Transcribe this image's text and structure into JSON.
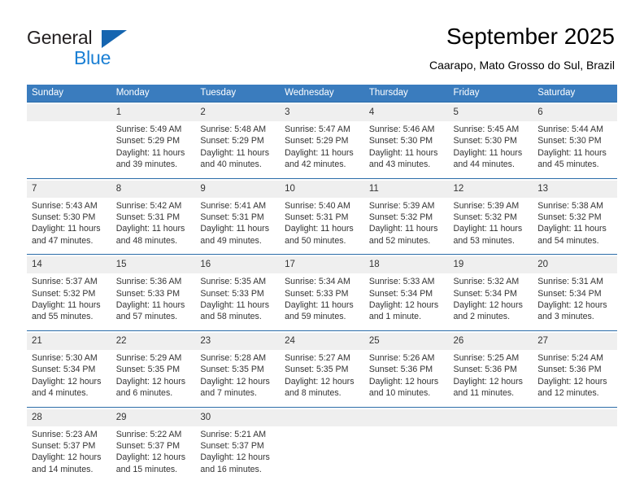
{
  "brand": {
    "name_top": "General",
    "name_bottom": "Blue",
    "accent_color": "#1a7fd4",
    "triangle_color": "#1565b0"
  },
  "header": {
    "title": "September 2025",
    "subtitle": "Caarapo, Mato Grosso do Sul, Brazil"
  },
  "theme": {
    "header_bg": "#3a7cbe",
    "week_rule": "#2b6ca8",
    "daynum_bg": "#efefef"
  },
  "weekdays": [
    "Sunday",
    "Monday",
    "Tuesday",
    "Wednesday",
    "Thursday",
    "Friday",
    "Saturday"
  ],
  "weeks": [
    [
      {
        "day": "",
        "sunrise": "",
        "sunset": "",
        "daylight_a": "",
        "daylight_b": ""
      },
      {
        "day": "1",
        "sunrise": "Sunrise: 5:49 AM",
        "sunset": "Sunset: 5:29 PM",
        "daylight_a": "Daylight: 11 hours",
        "daylight_b": "and 39 minutes."
      },
      {
        "day": "2",
        "sunrise": "Sunrise: 5:48 AM",
        "sunset": "Sunset: 5:29 PM",
        "daylight_a": "Daylight: 11 hours",
        "daylight_b": "and 40 minutes."
      },
      {
        "day": "3",
        "sunrise": "Sunrise: 5:47 AM",
        "sunset": "Sunset: 5:29 PM",
        "daylight_a": "Daylight: 11 hours",
        "daylight_b": "and 42 minutes."
      },
      {
        "day": "4",
        "sunrise": "Sunrise: 5:46 AM",
        "sunset": "Sunset: 5:30 PM",
        "daylight_a": "Daylight: 11 hours",
        "daylight_b": "and 43 minutes."
      },
      {
        "day": "5",
        "sunrise": "Sunrise: 5:45 AM",
        "sunset": "Sunset: 5:30 PM",
        "daylight_a": "Daylight: 11 hours",
        "daylight_b": "and 44 minutes."
      },
      {
        "day": "6",
        "sunrise": "Sunrise: 5:44 AM",
        "sunset": "Sunset: 5:30 PM",
        "daylight_a": "Daylight: 11 hours",
        "daylight_b": "and 45 minutes."
      }
    ],
    [
      {
        "day": "7",
        "sunrise": "Sunrise: 5:43 AM",
        "sunset": "Sunset: 5:30 PM",
        "daylight_a": "Daylight: 11 hours",
        "daylight_b": "and 47 minutes."
      },
      {
        "day": "8",
        "sunrise": "Sunrise: 5:42 AM",
        "sunset": "Sunset: 5:31 PM",
        "daylight_a": "Daylight: 11 hours",
        "daylight_b": "and 48 minutes."
      },
      {
        "day": "9",
        "sunrise": "Sunrise: 5:41 AM",
        "sunset": "Sunset: 5:31 PM",
        "daylight_a": "Daylight: 11 hours",
        "daylight_b": "and 49 minutes."
      },
      {
        "day": "10",
        "sunrise": "Sunrise: 5:40 AM",
        "sunset": "Sunset: 5:31 PM",
        "daylight_a": "Daylight: 11 hours",
        "daylight_b": "and 50 minutes."
      },
      {
        "day": "11",
        "sunrise": "Sunrise: 5:39 AM",
        "sunset": "Sunset: 5:32 PM",
        "daylight_a": "Daylight: 11 hours",
        "daylight_b": "and 52 minutes."
      },
      {
        "day": "12",
        "sunrise": "Sunrise: 5:39 AM",
        "sunset": "Sunset: 5:32 PM",
        "daylight_a": "Daylight: 11 hours",
        "daylight_b": "and 53 minutes."
      },
      {
        "day": "13",
        "sunrise": "Sunrise: 5:38 AM",
        "sunset": "Sunset: 5:32 PM",
        "daylight_a": "Daylight: 11 hours",
        "daylight_b": "and 54 minutes."
      }
    ],
    [
      {
        "day": "14",
        "sunrise": "Sunrise: 5:37 AM",
        "sunset": "Sunset: 5:32 PM",
        "daylight_a": "Daylight: 11 hours",
        "daylight_b": "and 55 minutes."
      },
      {
        "day": "15",
        "sunrise": "Sunrise: 5:36 AM",
        "sunset": "Sunset: 5:33 PM",
        "daylight_a": "Daylight: 11 hours",
        "daylight_b": "and 57 minutes."
      },
      {
        "day": "16",
        "sunrise": "Sunrise: 5:35 AM",
        "sunset": "Sunset: 5:33 PM",
        "daylight_a": "Daylight: 11 hours",
        "daylight_b": "and 58 minutes."
      },
      {
        "day": "17",
        "sunrise": "Sunrise: 5:34 AM",
        "sunset": "Sunset: 5:33 PM",
        "daylight_a": "Daylight: 11 hours",
        "daylight_b": "and 59 minutes."
      },
      {
        "day": "18",
        "sunrise": "Sunrise: 5:33 AM",
        "sunset": "Sunset: 5:34 PM",
        "daylight_a": "Daylight: 12 hours",
        "daylight_b": "and 1 minute."
      },
      {
        "day": "19",
        "sunrise": "Sunrise: 5:32 AM",
        "sunset": "Sunset: 5:34 PM",
        "daylight_a": "Daylight: 12 hours",
        "daylight_b": "and 2 minutes."
      },
      {
        "day": "20",
        "sunrise": "Sunrise: 5:31 AM",
        "sunset": "Sunset: 5:34 PM",
        "daylight_a": "Daylight: 12 hours",
        "daylight_b": "and 3 minutes."
      }
    ],
    [
      {
        "day": "21",
        "sunrise": "Sunrise: 5:30 AM",
        "sunset": "Sunset: 5:34 PM",
        "daylight_a": "Daylight: 12 hours",
        "daylight_b": "and 4 minutes."
      },
      {
        "day": "22",
        "sunrise": "Sunrise: 5:29 AM",
        "sunset": "Sunset: 5:35 PM",
        "daylight_a": "Daylight: 12 hours",
        "daylight_b": "and 6 minutes."
      },
      {
        "day": "23",
        "sunrise": "Sunrise: 5:28 AM",
        "sunset": "Sunset: 5:35 PM",
        "daylight_a": "Daylight: 12 hours",
        "daylight_b": "and 7 minutes."
      },
      {
        "day": "24",
        "sunrise": "Sunrise: 5:27 AM",
        "sunset": "Sunset: 5:35 PM",
        "daylight_a": "Daylight: 12 hours",
        "daylight_b": "and 8 minutes."
      },
      {
        "day": "25",
        "sunrise": "Sunrise: 5:26 AM",
        "sunset": "Sunset: 5:36 PM",
        "daylight_a": "Daylight: 12 hours",
        "daylight_b": "and 10 minutes."
      },
      {
        "day": "26",
        "sunrise": "Sunrise: 5:25 AM",
        "sunset": "Sunset: 5:36 PM",
        "daylight_a": "Daylight: 12 hours",
        "daylight_b": "and 11 minutes."
      },
      {
        "day": "27",
        "sunrise": "Sunrise: 5:24 AM",
        "sunset": "Sunset: 5:36 PM",
        "daylight_a": "Daylight: 12 hours",
        "daylight_b": "and 12 minutes."
      }
    ],
    [
      {
        "day": "28",
        "sunrise": "Sunrise: 5:23 AM",
        "sunset": "Sunset: 5:37 PM",
        "daylight_a": "Daylight: 12 hours",
        "daylight_b": "and 14 minutes."
      },
      {
        "day": "29",
        "sunrise": "Sunrise: 5:22 AM",
        "sunset": "Sunset: 5:37 PM",
        "daylight_a": "Daylight: 12 hours",
        "daylight_b": "and 15 minutes."
      },
      {
        "day": "30",
        "sunrise": "Sunrise: 5:21 AM",
        "sunset": "Sunset: 5:37 PM",
        "daylight_a": "Daylight: 12 hours",
        "daylight_b": "and 16 minutes."
      },
      {
        "day": "",
        "sunrise": "",
        "sunset": "",
        "daylight_a": "",
        "daylight_b": ""
      },
      {
        "day": "",
        "sunrise": "",
        "sunset": "",
        "daylight_a": "",
        "daylight_b": ""
      },
      {
        "day": "",
        "sunrise": "",
        "sunset": "",
        "daylight_a": "",
        "daylight_b": ""
      },
      {
        "day": "",
        "sunrise": "",
        "sunset": "",
        "daylight_a": "",
        "daylight_b": ""
      }
    ]
  ]
}
